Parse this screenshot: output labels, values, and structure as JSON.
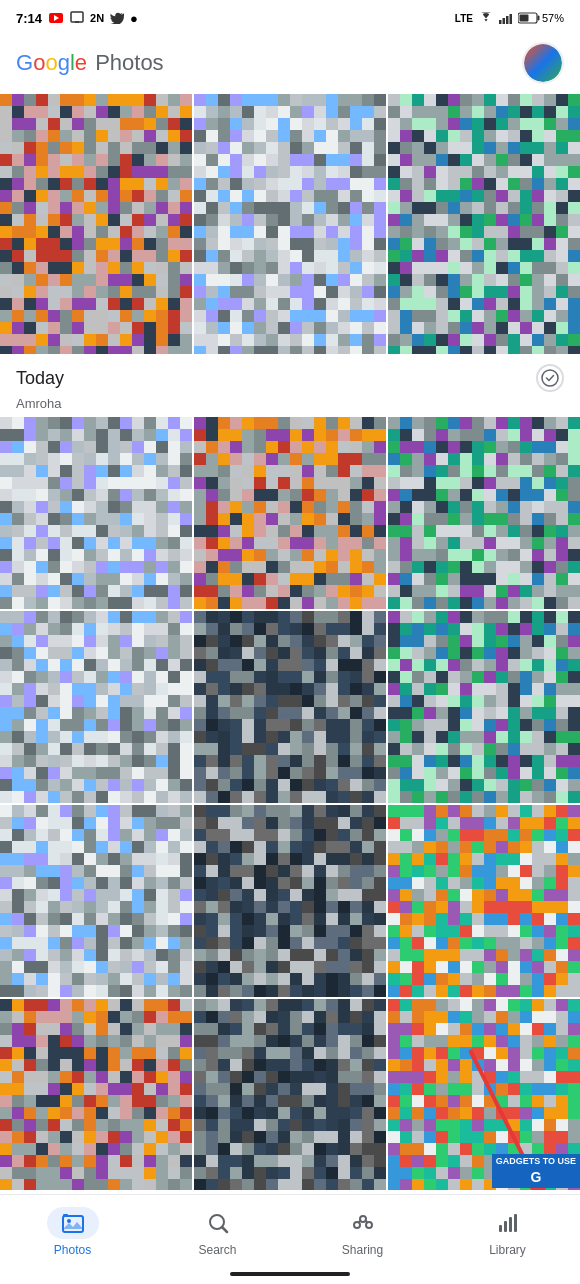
{
  "status": {
    "time": "7:14",
    "battery": "57%",
    "signal": "●●●",
    "wifi": "WiFi",
    "lte": "LTE"
  },
  "header": {
    "logo_google": "Google",
    "logo_photos": " Photos",
    "avatar_alt": "User avatar"
  },
  "section": {
    "date": "Today",
    "location": "Amroha"
  },
  "bottomNav": {
    "items": [
      {
        "id": "photos",
        "label": "Photos",
        "active": true
      },
      {
        "id": "search",
        "label": "Search",
        "active": false
      },
      {
        "id": "sharing",
        "label": "Sharing",
        "active": false
      },
      {
        "id": "library",
        "label": "Library",
        "active": false
      }
    ]
  },
  "watermark": {
    "line1": "GADGETS TO USE",
    "icon": "G"
  }
}
